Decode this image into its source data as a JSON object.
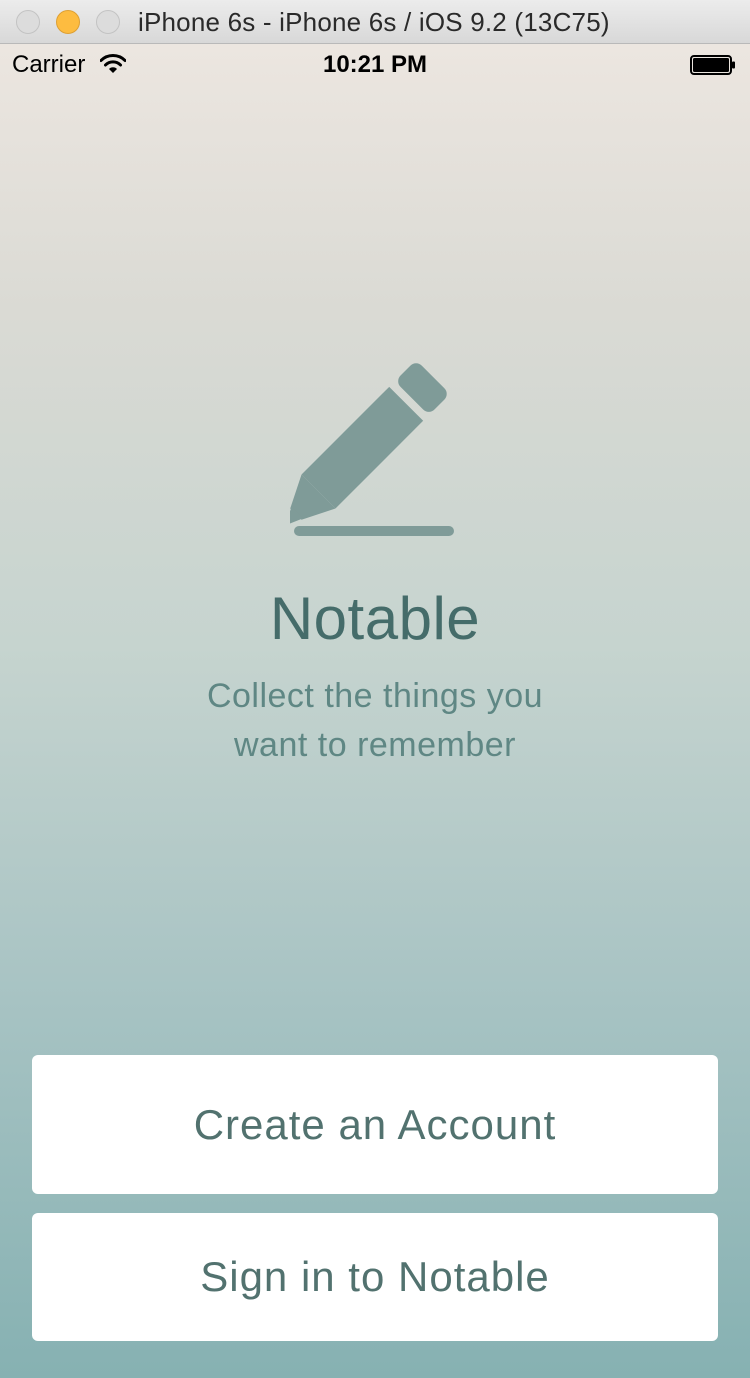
{
  "window": {
    "title": "iPhone 6s - iPhone 6s / iOS 9.2 (13C75)"
  },
  "status_bar": {
    "carrier": "Carrier",
    "time": "10:21 PM",
    "icons": [
      "wifi-icon",
      "battery-icon"
    ]
  },
  "hero": {
    "icon": "pencil-icon",
    "title": "Notable",
    "tagline_line1": "Collect the things you",
    "tagline_line2": "want to remember"
  },
  "actions": {
    "create_account_label": "Create an Account",
    "sign_in_label": "Sign in to Notable"
  },
  "colors": {
    "accent_text": "#456c6a",
    "logo": "#7f9b98",
    "button_bg": "#ffffff",
    "traffic_minimize": "#fdbc40"
  }
}
